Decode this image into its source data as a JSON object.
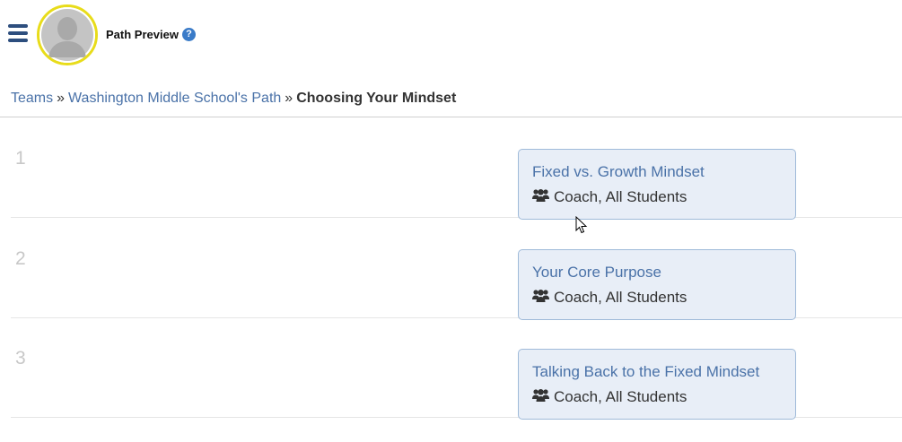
{
  "header": {
    "title": "Path Preview",
    "help_glyph": "?"
  },
  "breadcrumb": {
    "items": [
      "Teams",
      "Washington Middle School's Path"
    ],
    "separator": "»",
    "current": "Choosing Your Mindset"
  },
  "steps": [
    {
      "number": "1",
      "title": "Fixed vs. Growth Mindset",
      "audience": "Coach, All Students"
    },
    {
      "number": "2",
      "title": "Your Core Purpose",
      "audience": "Coach, All Students"
    },
    {
      "number": "3",
      "title": "Talking Back to the Fixed Mindset",
      "audience": "Coach, All Students"
    }
  ],
  "icons": {
    "menu": "hamburger-icon",
    "avatar": "user-silhouette",
    "help": "question-circle-icon",
    "audience": "users-icon"
  },
  "colors": {
    "link": "#4a72a8",
    "menu": "#2d4e7e",
    "avatar_ring": "#e8dc1a",
    "card_bg": "#e8eef7",
    "card_border": "#9fbad9",
    "help": "#3a7bc8"
  }
}
